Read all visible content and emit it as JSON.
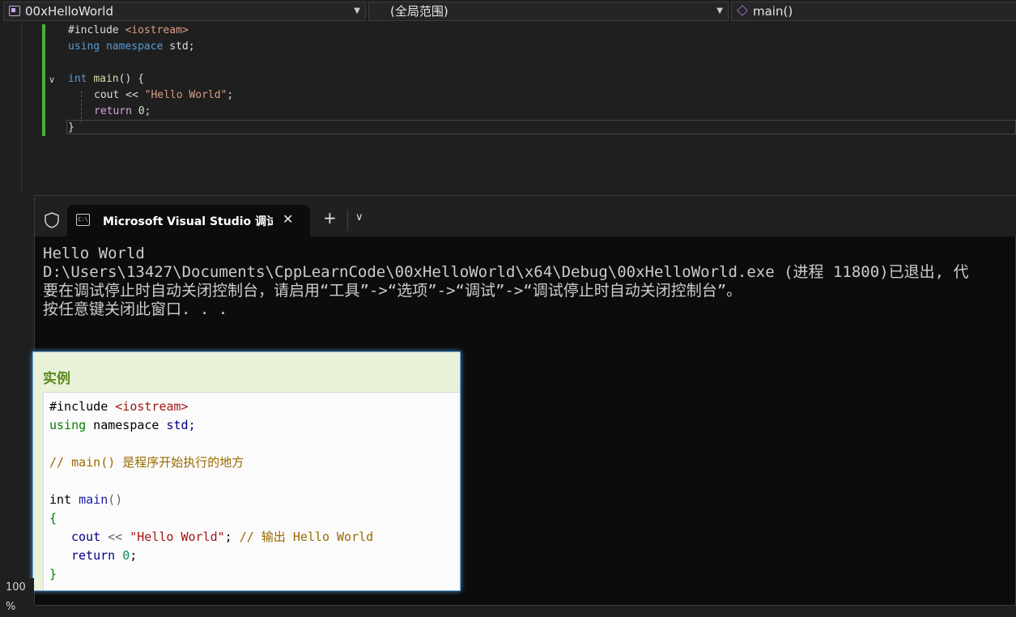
{
  "navbar": {
    "project": "00xHelloWorld",
    "scope": "(全局范围)",
    "function": "main()"
  },
  "editor": {
    "lines": [
      {
        "pre": "#include ",
        "str": "<iostream>"
      },
      {
        "kw": "using",
        "kw2": "namespace",
        "rest": " std;"
      },
      {
        "kw": "int",
        "fn": "main",
        "rest": "() {"
      },
      {
        "a": "cout << ",
        "str": "\"Hello World\"",
        "b": ";"
      },
      {
        "kw": "return",
        "rest": " 0;"
      },
      {
        "rest": "}"
      }
    ]
  },
  "terminal": {
    "tab_title": "Microsoft Visual Studio 调试控",
    "output": [
      "Hello World",
      "D:\\Users\\13427\\Documents\\CppLearnCode\\00xHelloWorld\\x64\\Debug\\00xHelloWorld.exe (进程 11800)已退出, 代",
      "要在调试停止时自动关闭控制台，请启用“工具”->“选项”->“调试”->“调试停止时自动关闭控制台”。",
      "按任意键关闭此窗口. . ."
    ]
  },
  "popup": {
    "title": "实例",
    "code": {
      "l1a": "#include ",
      "l1b": "<iostream>",
      "l2a": "using",
      "l2b": " namespace ",
      "l2c": "std;",
      "l3": "// main() 是程序开始执行的地方",
      "l4a": "int ",
      "l4b": "main",
      "l4c": "()",
      "l5": "{",
      "l6a": "cout",
      "l6b": " << ",
      "l6c": "\"Hello World\"",
      "l6d": "; ",
      "l6e": "// 输出 Hello World",
      "l7a": "return ",
      "l7b": "0",
      "l7c": ";",
      "l8": "}"
    }
  },
  "status": {
    "zoom": "100 %"
  },
  "colors": {
    "accent_green": "#4caf3a",
    "popup_title": "#5b8a1e"
  }
}
